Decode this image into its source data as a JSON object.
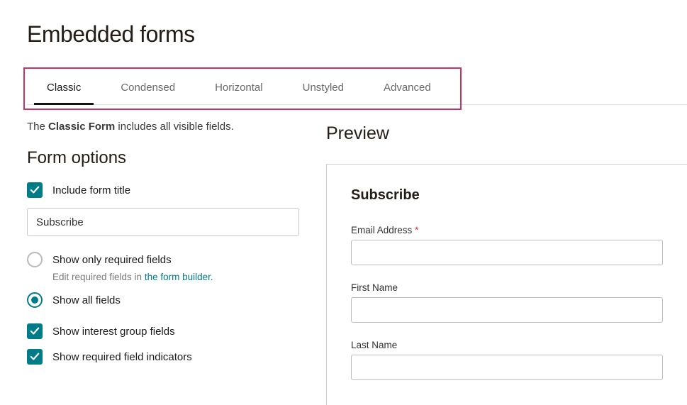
{
  "page_title": "Embedded forms",
  "tabs": {
    "items": [
      {
        "label": "Classic",
        "active": true
      },
      {
        "label": "Condensed",
        "active": false
      },
      {
        "label": "Horizontal",
        "active": false
      },
      {
        "label": "Unstyled",
        "active": false
      },
      {
        "label": "Advanced",
        "active": false
      }
    ]
  },
  "description": {
    "pre": "The ",
    "strong": "Classic Form",
    "post": " includes all visible fields."
  },
  "form_options": {
    "title": "Form options",
    "include_title": {
      "label": "Include form title",
      "checked": true
    },
    "title_input_value": "Subscribe",
    "field_visibility": {
      "only_required": {
        "label": "Show only required fields",
        "selected": false
      },
      "hint_pre": "Edit required fields in ",
      "hint_link": "the form builder.",
      "show_all": {
        "label": "Show all fields",
        "selected": true
      }
    },
    "show_interest_groups": {
      "label": "Show interest group fields",
      "checked": true
    },
    "show_required_indicators": {
      "label": "Show required field indicators",
      "checked": true
    }
  },
  "preview": {
    "title": "Preview",
    "heading": "Subscribe",
    "fields": {
      "email": {
        "label": "Email Address",
        "required": true
      },
      "first_name": {
        "label": "First Name",
        "required": false
      },
      "last_name": {
        "label": "Last Name",
        "required": false
      }
    },
    "required_mark": "*"
  }
}
